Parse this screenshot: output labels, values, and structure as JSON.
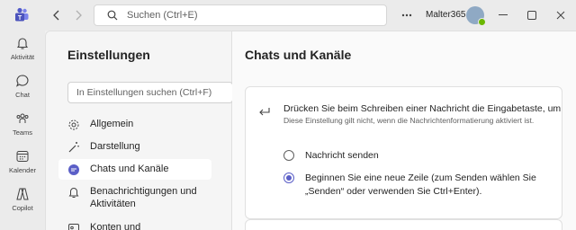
{
  "header": {
    "search_placeholder": "Suchen (Ctrl+E)",
    "org_name": "Malter365"
  },
  "rail": {
    "items": [
      {
        "label": "Aktivität",
        "icon": "bell-icon"
      },
      {
        "label": "Chat",
        "icon": "chat-icon"
      },
      {
        "label": "Teams",
        "icon": "teams-icon"
      },
      {
        "label": "Kalender",
        "icon": "calendar-icon"
      },
      {
        "label": "Copilot",
        "icon": "copilot-icon"
      }
    ]
  },
  "settings": {
    "title": "Einstellungen",
    "search_placeholder": "In Einstellungen suchen (Ctrl+F)",
    "items": [
      {
        "label": "Allgemein",
        "icon": "gear-icon"
      },
      {
        "label": "Darstellung",
        "icon": "wand-icon"
      },
      {
        "label": "Chats und Kanäle",
        "icon": "chat-bubble-icon",
        "active": true
      },
      {
        "label": "Benachrichtigungen und Aktivitäten",
        "icon": "bell-icon"
      },
      {
        "label": "Konten und",
        "icon": "account-icon"
      }
    ]
  },
  "content": {
    "title": "Chats und Kanäle",
    "enter_setting": {
      "heading": "Drücken Sie beim Schreiben einer Nachricht die Eingabetaste, um",
      "subtext": "Diese Einstellung gilt nicht, wenn die Nachrichtenformatierung aktiviert ist.",
      "options": [
        {
          "label": "Nachricht senden",
          "checked": false
        },
        {
          "label": "Beginnen Sie eine neue Zeile (zum Senden wählen Sie „Senden“ oder verwenden Sie Ctrl+Enter).",
          "checked": true
        }
      ]
    }
  },
  "colors": {
    "accent": "#5b5fc7",
    "presence": "#6bb700"
  }
}
